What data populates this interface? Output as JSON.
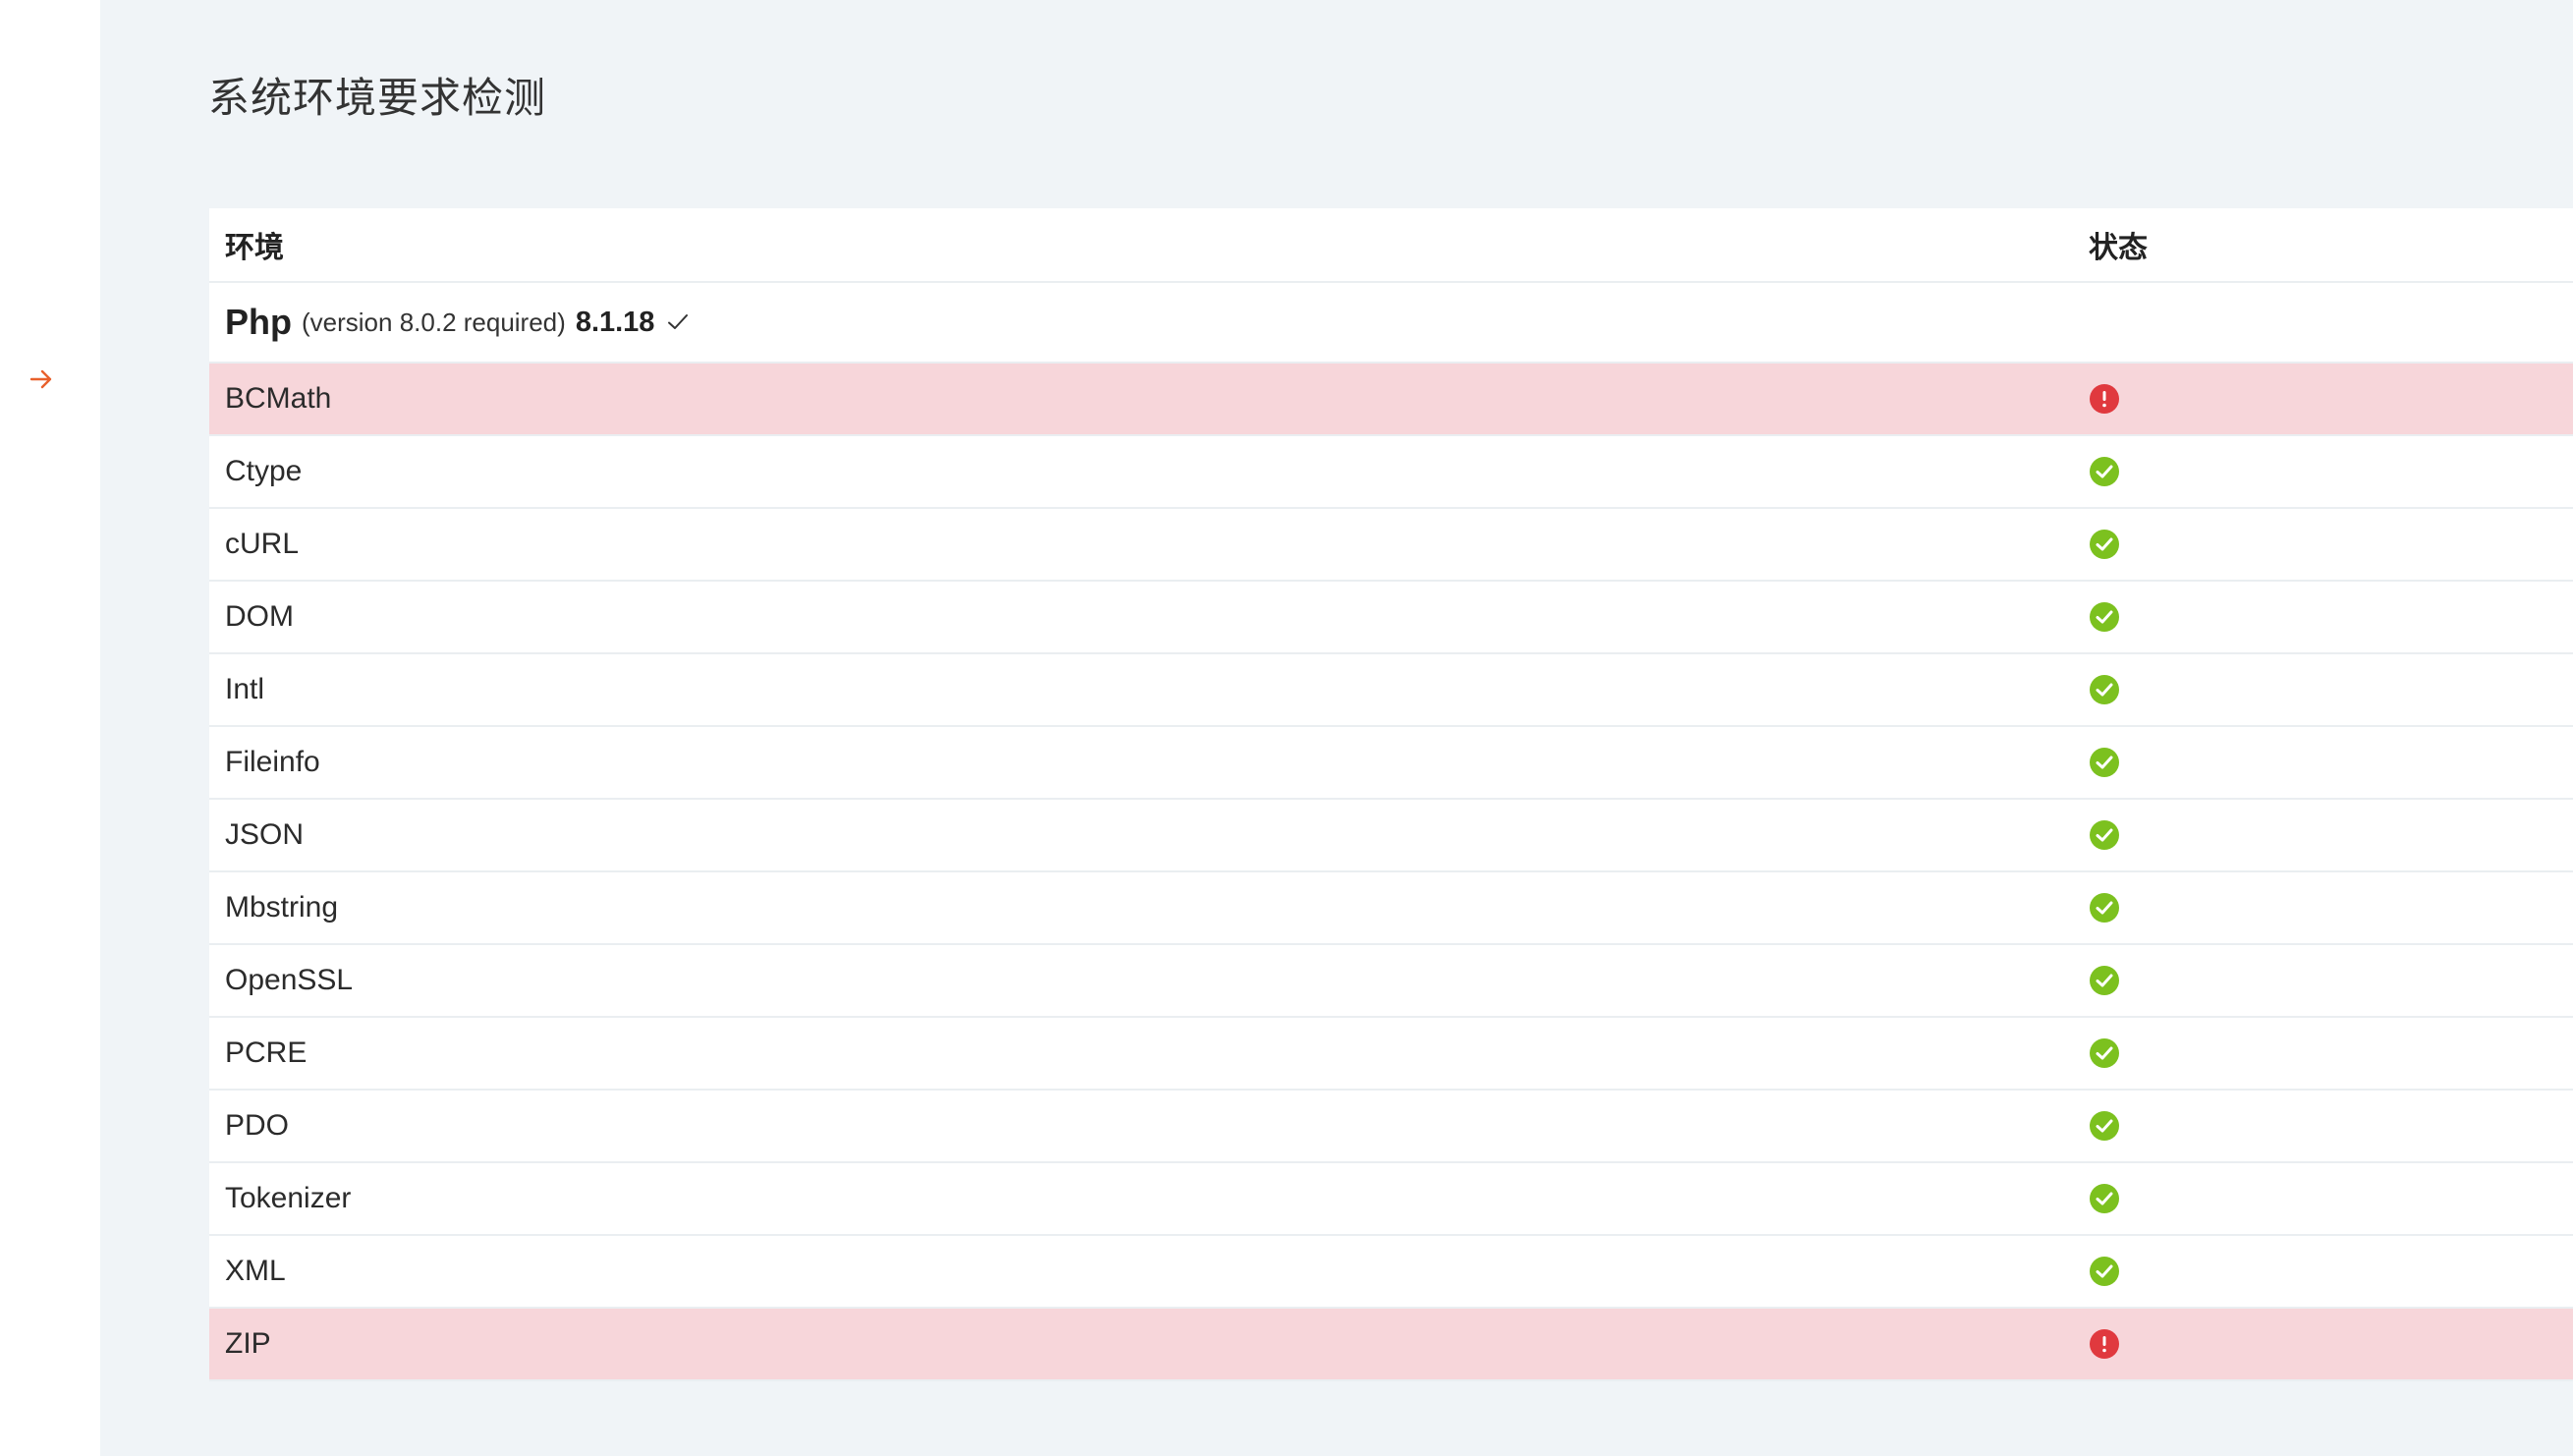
{
  "page": {
    "title": "系统环境要求检测"
  },
  "table": {
    "headers": {
      "environment": "环境",
      "status": "状态"
    },
    "php": {
      "name": "Php",
      "required": "(version 8.0.2 required)",
      "current": "8.1.18",
      "check_icon": "checkmark-icon"
    },
    "rows": [
      {
        "name": "BCMath",
        "status": "fail"
      },
      {
        "name": "Ctype",
        "status": "ok"
      },
      {
        "name": "cURL",
        "status": "ok"
      },
      {
        "name": "DOM",
        "status": "ok"
      },
      {
        "name": "Intl",
        "status": "ok"
      },
      {
        "name": "Fileinfo",
        "status": "ok"
      },
      {
        "name": "JSON",
        "status": "ok"
      },
      {
        "name": "Mbstring",
        "status": "ok"
      },
      {
        "name": "OpenSSL",
        "status": "ok"
      },
      {
        "name": "PCRE",
        "status": "ok"
      },
      {
        "name": "PDO",
        "status": "ok"
      },
      {
        "name": "Tokenizer",
        "status": "ok"
      },
      {
        "name": "XML",
        "status": "ok"
      },
      {
        "name": "ZIP",
        "status": "fail"
      }
    ]
  },
  "icons": {
    "nav": "arrow-right-icon",
    "ok": "check-circle-icon",
    "fail": "error-circle-icon"
  },
  "colors": {
    "ok": "#7cc11f",
    "fail": "#e0393e",
    "fail_row_bg": "#f7d6da",
    "nav_arrow": "#e8602c",
    "main_bg": "#f0f4f7"
  }
}
